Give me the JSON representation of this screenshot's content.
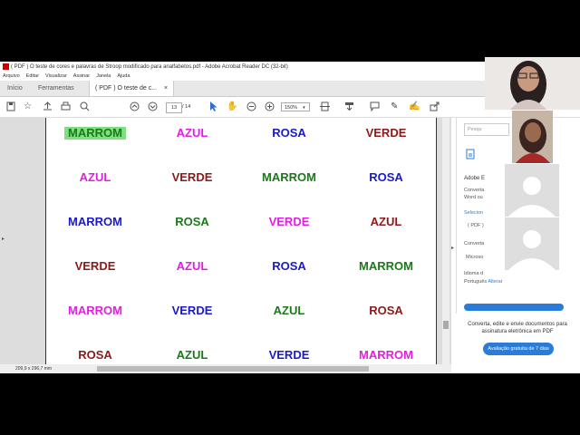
{
  "window": {
    "title": "( PDF ) O teste de cores e palavras de Stroop modificado para analfabetos.pdf - Adobe Acrobat Reader DC (32-bit)"
  },
  "menu": [
    "Arquivo",
    "Editar",
    "Visualizar",
    "Assinar",
    "Janela",
    "Ajuda"
  ],
  "tabs": {
    "home": "Início",
    "tools": "Ferramentas",
    "doc": "( PDF ) O teste de c...",
    "close": "×"
  },
  "toolbar": {
    "page_current": "13",
    "page_total": "/ 14",
    "zoom": "150%"
  },
  "stroop": {
    "rows": [
      [
        {
          "text": "MARROM",
          "color": "#1a7a1a"
        },
        {
          "text": "AZUL",
          "color": "#e21fe0"
        },
        {
          "text": "ROSA",
          "color": "#1a1ac8"
        },
        {
          "text": "VERDE",
          "color": "#8b1a1a"
        }
      ],
      [
        {
          "text": "AZUL",
          "color": "#e21fe0"
        },
        {
          "text": "VERDE",
          "color": "#8b1a1a"
        },
        {
          "text": "MARROM",
          "color": "#1a7a1a"
        },
        {
          "text": "ROSA",
          "color": "#1a1ac8"
        }
      ],
      [
        {
          "text": "MARROM",
          "color": "#1a1ac8"
        },
        {
          "text": "ROSA",
          "color": "#1a7a1a"
        },
        {
          "text": "VERDE",
          "color": "#e21fe0"
        },
        {
          "text": "AZUL",
          "color": "#8b1a1a"
        }
      ],
      [
        {
          "text": "VERDE",
          "color": "#8b1a1a"
        },
        {
          "text": "AZUL",
          "color": "#e21fe0"
        },
        {
          "text": "ROSA",
          "color": "#1a1ac8"
        },
        {
          "text": "MARROM",
          "color": "#1a7a1a"
        }
      ],
      [
        {
          "text": "MARROM",
          "color": "#e21fe0"
        },
        {
          "text": "VERDE",
          "color": "#1a1ac8"
        },
        {
          "text": "AZUL",
          "color": "#1a7a1a"
        },
        {
          "text": "ROSA",
          "color": "#8b1a1a"
        }
      ],
      [
        {
          "text": "ROSA",
          "color": "#8b1a1a"
        },
        {
          "text": "AZUL",
          "color": "#1a7a1a"
        },
        {
          "text": "VERDE",
          "color": "#1a1ac8"
        },
        {
          "text": "MARROM",
          "color": "#e21fe0"
        }
      ]
    ],
    "highlight_color": "#7ee07e"
  },
  "status": {
    "page_size": "209,9 x 296,7 mm"
  },
  "right_panel": {
    "search_placeholder": "Pesqu",
    "adobe": "Adobe E",
    "convert1": "Converta",
    "convert2": "Word ou",
    "select": "Selecion",
    "pdf": "( PDF )",
    "convert3": "Converta",
    "microsoft": "Microso",
    "lang": "Idioma d",
    "portugues": "Português",
    "alterar": "Alterar"
  },
  "promo": {
    "text": "Converta, edite e envie documentos para assinatura eletrônica em PDF",
    "button": "Avaliação gratuita de 7 dias"
  }
}
